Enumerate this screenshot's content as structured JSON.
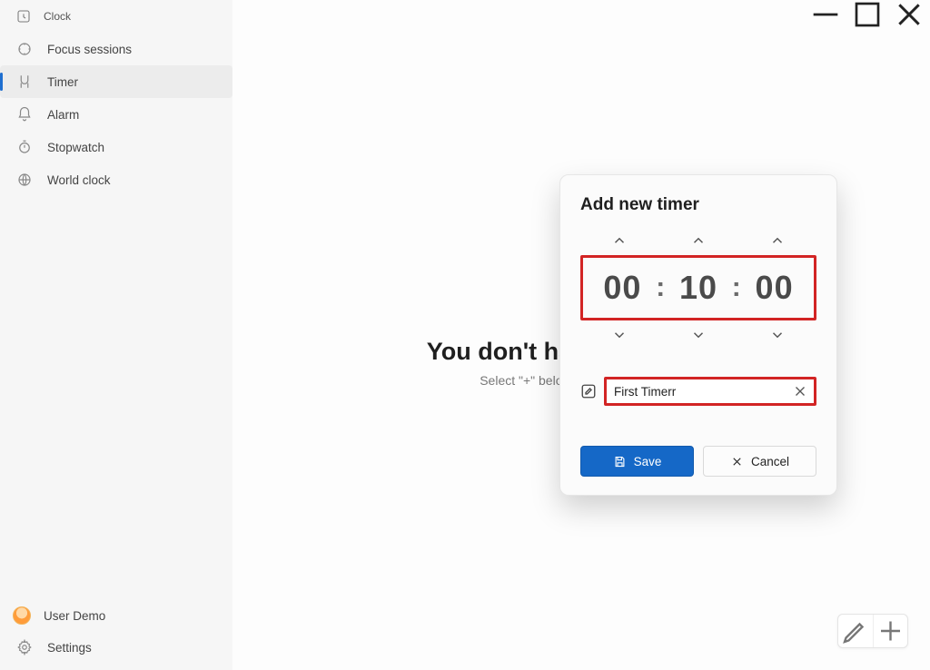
{
  "app_title": "Clock",
  "sidebar": {
    "items": [
      {
        "label": "Focus sessions",
        "icon": "focus-icon"
      },
      {
        "label": "Timer",
        "icon": "timer-icon"
      },
      {
        "label": "Alarm",
        "icon": "alarm-icon"
      },
      {
        "label": "Stopwatch",
        "icon": "stopwatch-icon"
      },
      {
        "label": "World clock",
        "icon": "world-clock-icon"
      }
    ],
    "active_index": 1
  },
  "user": {
    "name": "User Demo"
  },
  "settings_label": "Settings",
  "empty_state": {
    "headline": "You don't have any timers.",
    "sub": "Select \"+\" below to add a new timer."
  },
  "dialog": {
    "title": "Add new timer",
    "time": {
      "hours": "00",
      "minutes": "10",
      "seconds": "00"
    },
    "name_value": "First Timerr",
    "save_label": "Save",
    "cancel_label": "Cancel"
  }
}
